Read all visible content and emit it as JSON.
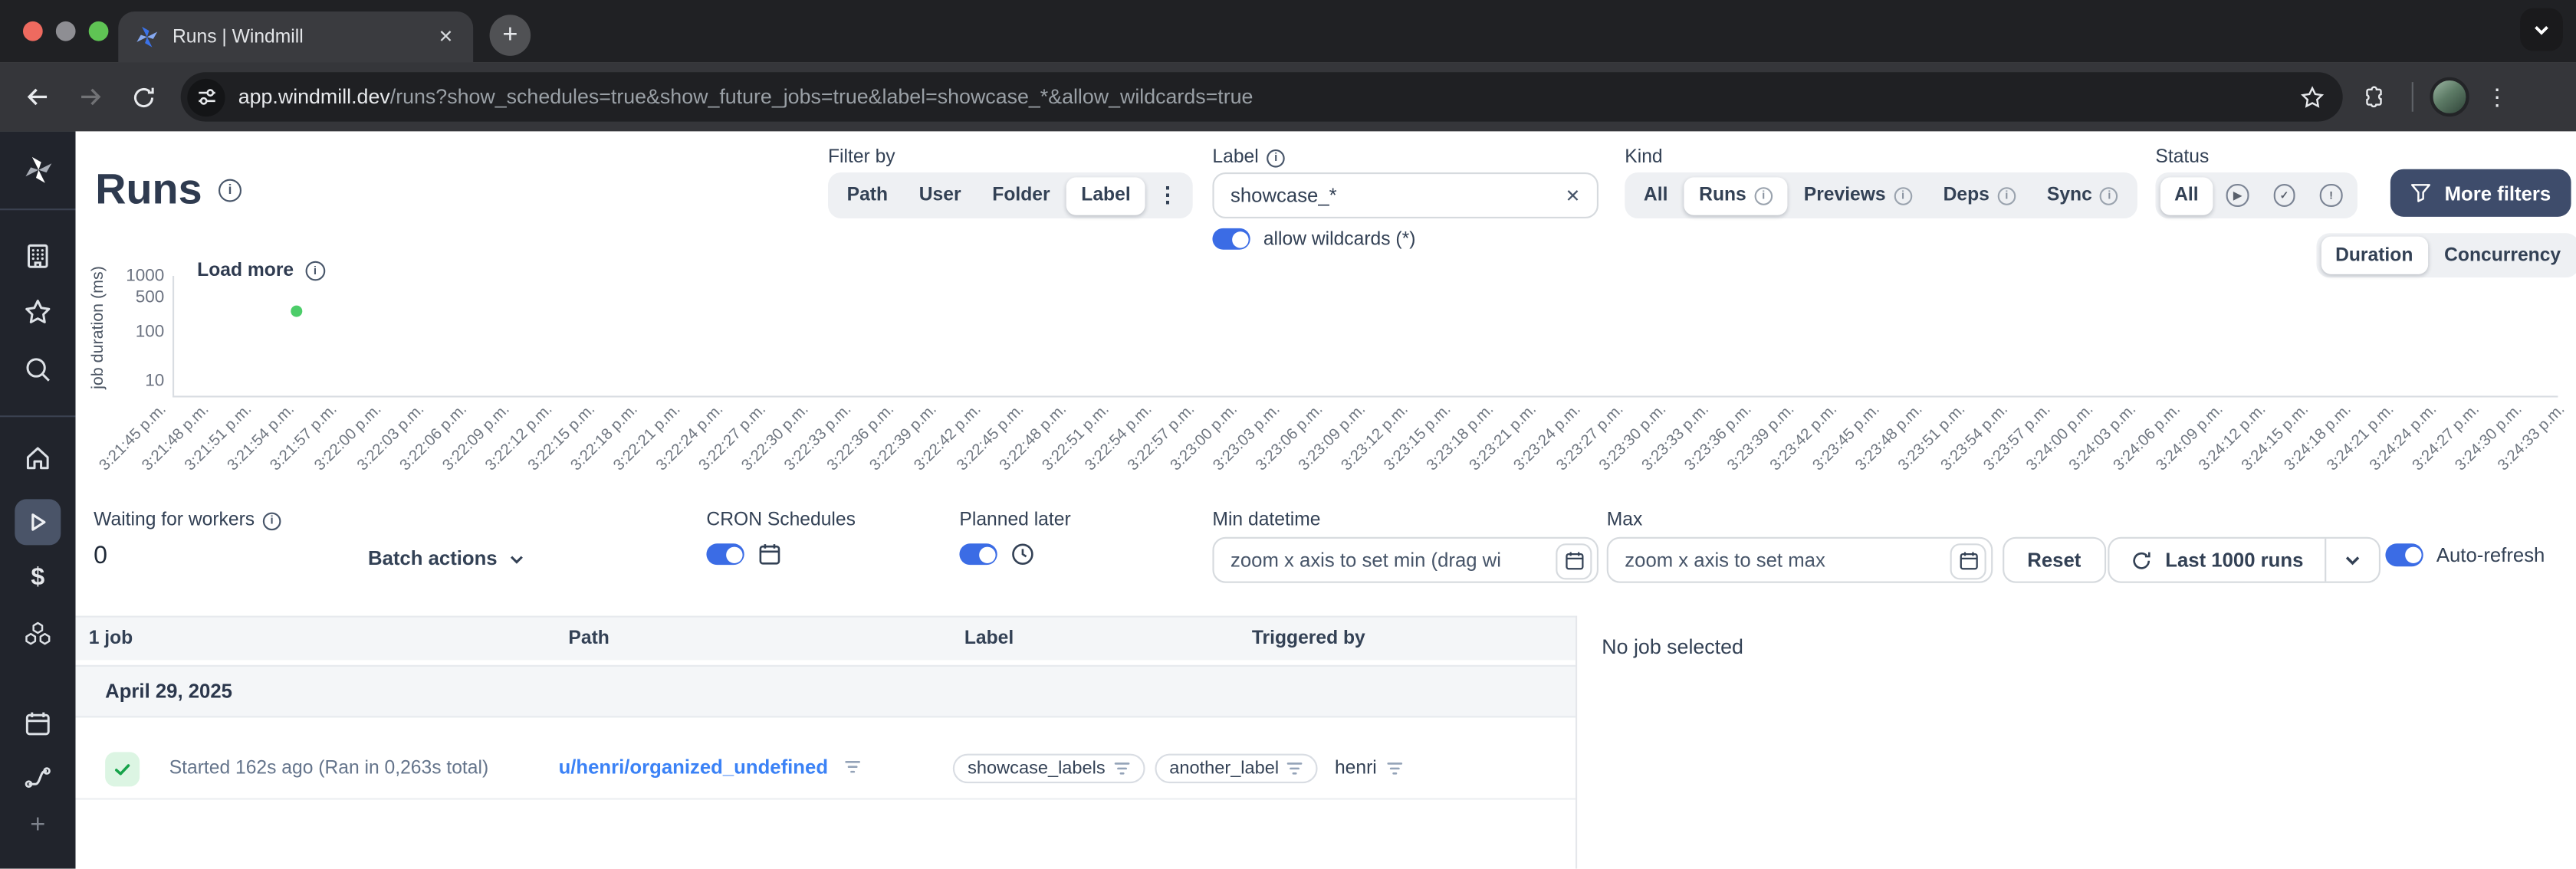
{
  "browser": {
    "tab_title": "Runs | Windmill",
    "url_host": "app.windmill.dev",
    "url_path": "/runs?show_schedules=true&show_future_jobs=true&label=showcase_*&allow_wildcards=true"
  },
  "page": {
    "title": "Runs",
    "filter_by": {
      "label": "Filter by",
      "options": [
        "Path",
        "User",
        "Folder",
        "Label"
      ],
      "selected": "Label"
    },
    "label_filter": {
      "label": "Label",
      "value": "showcase_*",
      "wildcards_label": "allow wildcards (*)"
    },
    "kind": {
      "label": "Kind",
      "options": [
        "All",
        "Runs",
        "Previews",
        "Deps",
        "Sync"
      ],
      "selected": "Runs",
      "info_on": [
        "Runs",
        "Previews",
        "Deps",
        "Sync"
      ]
    },
    "status": {
      "label": "Status",
      "all_label": "All",
      "icons": [
        {
          "name": "status-running-icon",
          "glyph": "▶"
        },
        {
          "name": "status-success-icon",
          "glyph": "✓"
        },
        {
          "name": "status-failure-icon",
          "glyph": "!"
        }
      ]
    },
    "more_filters_label": "More filters",
    "view_toggle": {
      "options": [
        "Duration",
        "Concurrency"
      ],
      "selected": "Duration"
    },
    "chart": {
      "type": "scatter",
      "load_more_label": "Load more",
      "ylabel": "job duration (ms)",
      "yticks": [
        "1000",
        "500",
        "100",
        "10"
      ],
      "points": [
        {
          "time": "3:21:54 p.m.",
          "duration_ms": 263,
          "color": "#4ccd69"
        }
      ],
      "x_labels": [
        "3:21:45 p.m.",
        "3:21:48 p.m.",
        "3:21:51 p.m.",
        "3:21:54 p.m.",
        "3:21:57 p.m.",
        "3:22:00 p.m.",
        "3:22:03 p.m.",
        "3:22:06 p.m.",
        "3:22:09 p.m.",
        "3:22:12 p.m.",
        "3:22:15 p.m.",
        "3:22:18 p.m.",
        "3:22:21 p.m.",
        "3:22:24 p.m.",
        "3:22:27 p.m.",
        "3:22:30 p.m.",
        "3:22:33 p.m.",
        "3:22:36 p.m.",
        "3:22:39 p.m.",
        "3:22:42 p.m.",
        "3:22:45 p.m.",
        "3:22:48 p.m.",
        "3:22:51 p.m.",
        "3:22:54 p.m.",
        "3:22:57 p.m.",
        "3:23:00 p.m.",
        "3:23:03 p.m.",
        "3:23:06 p.m.",
        "3:23:09 p.m.",
        "3:23:12 p.m.",
        "3:23:15 p.m.",
        "3:23:18 p.m.",
        "3:23:21 p.m.",
        "3:23:24 p.m.",
        "3:23:27 p.m.",
        "3:23:30 p.m.",
        "3:23:33 p.m.",
        "3:23:36 p.m.",
        "3:23:39 p.m.",
        "3:23:42 p.m.",
        "3:23:45 p.m.",
        "3:23:48 p.m.",
        "3:23:51 p.m.",
        "3:23:54 p.m.",
        "3:23:57 p.m.",
        "3:24:00 p.m.",
        "3:24:03 p.m.",
        "3:24:06 p.m.",
        "3:24:09 p.m.",
        "3:24:12 p.m.",
        "3:24:15 p.m.",
        "3:24:18 p.m.",
        "3:24:21 p.m.",
        "3:24:24 p.m.",
        "3:24:27 p.m.",
        "3:24:30 p.m.",
        "3:24:33 p.m."
      ]
    },
    "controls": {
      "waiting_label": "Waiting for workers",
      "waiting_value": "0",
      "batch_actions_label": "Batch actions",
      "cron_label": "CRON Schedules",
      "planned_label": "Planned later",
      "min_label": "Min datetime",
      "min_placeholder": "zoom x axis to set min (drag wi",
      "max_label": "Max",
      "max_placeholder": "zoom x axis to set max",
      "reset_label": "Reset",
      "last_runs_label": "Last 1000 runs",
      "auto_refresh_label": "Auto-refresh"
    },
    "table": {
      "count_label": "1 job",
      "columns": [
        "Path",
        "Label",
        "Triggered by"
      ],
      "date_group": "April 29, 2025",
      "row": {
        "status_text": "Started 162s ago (Ran in 0,263s total)",
        "path": "u/henri/organized_undefined",
        "labels": [
          "showcase_labels",
          "another_label"
        ],
        "triggered_by": "henri"
      }
    },
    "detail_panel": {
      "empty_text": "No job selected"
    }
  },
  "colors": {
    "accent_blue": "#3b6ce5",
    "link_blue": "#3b82f6",
    "dark_navy": "#334155",
    "more_filters_bg": "#3e4c6b",
    "success_green": "#16a34a",
    "dot_green": "#4ccd69"
  }
}
